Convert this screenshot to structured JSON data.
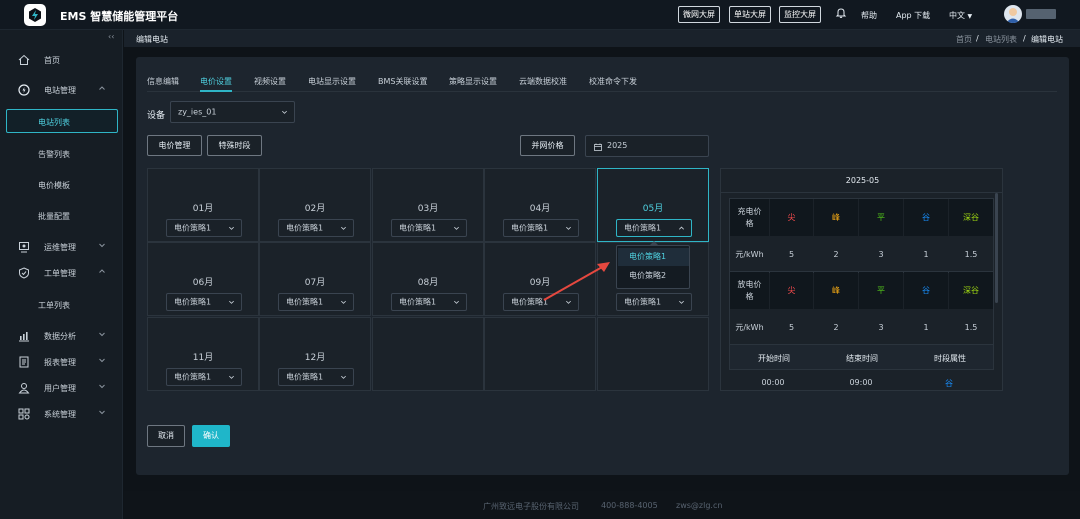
{
  "app": {
    "title": "EMS 智慧储能管理平台"
  },
  "topbar": {
    "buttons": [
      "微网大屏",
      "单站大屏",
      "监控大屏"
    ],
    "help": "帮助",
    "app_download": "App 下载",
    "language": "中文"
  },
  "sidebar": {
    "items": [
      {
        "label": "首页",
        "icon": "home-icon"
      },
      {
        "label": "电站管理",
        "icon": "station-icon"
      },
      {
        "label": "运维管理",
        "icon": "maintenance-icon"
      },
      {
        "label": "工单管理",
        "icon": "workorder-icon"
      },
      {
        "label": "数据分析",
        "icon": "chart-icon"
      },
      {
        "label": "报表管理",
        "icon": "report-icon"
      },
      {
        "label": "用户管理",
        "icon": "user-icon"
      },
      {
        "label": "系统管理",
        "icon": "system-icon"
      }
    ],
    "station_subitems": [
      "电站列表",
      "告警列表",
      "电价模板",
      "批量配置"
    ],
    "workorder_subitems": [
      "工单列表"
    ]
  },
  "breadcrumb": {
    "page_title": "编辑电站",
    "items": [
      "首页",
      "电站列表",
      "编辑电站"
    ]
  },
  "tabs": [
    "信息编辑",
    "电价设置",
    "视频设置",
    "电站显示设置",
    "BMS关联设置",
    "策略显示设置",
    "云端数据校准",
    "校准命令下发"
  ],
  "active_tab": 1,
  "device": {
    "label": "设备",
    "value": "zy_ies_01"
  },
  "buttons": {
    "price_manage": "电价管理",
    "special_period": "特殊时段",
    "grid_price": "并网价格",
    "cancel": "取消",
    "confirm": "确认"
  },
  "year": "2025",
  "months": [
    {
      "label": "01月",
      "strategy": "电价策略1"
    },
    {
      "label": "02月",
      "strategy": "电价策略1"
    },
    {
      "label": "03月",
      "strategy": "电价策略1"
    },
    {
      "label": "04月",
      "strategy": "电价策略1"
    },
    {
      "label": "05月",
      "strategy": "电价策略1"
    },
    {
      "label": "06月",
      "strategy": "电价策略1"
    },
    {
      "label": "07月",
      "strategy": "电价策略1"
    },
    {
      "label": "08月",
      "strategy": "电价策略1"
    },
    {
      "label": "09月",
      "strategy": "电价策略1"
    },
    {
      "label": "",
      "strategy": "电价策略1"
    },
    {
      "label": "11月",
      "strategy": "电价策略1"
    },
    {
      "label": "12月",
      "strategy": "电价策略1"
    }
  ],
  "dropdown_options": [
    "电价策略1",
    "电价策略2"
  ],
  "price_panel": {
    "title": "2025-05",
    "charge_label": "充电价格",
    "discharge_label": "放电价格",
    "unit": "元/kWh",
    "tiers": [
      {
        "name": "尖",
        "color": "#ff4d4f"
      },
      {
        "name": "峰",
        "color": "#faad14"
      },
      {
        "name": "平",
        "color": "#52c41a"
      },
      {
        "name": "谷",
        "color": "#1890ff"
      },
      {
        "name": "深谷",
        "color": "#a0d911"
      }
    ],
    "charge_values": [
      "5",
      "2",
      "3",
      "1",
      "1.5"
    ],
    "discharge_values": [
      "5",
      "2",
      "3",
      "1",
      "1.5"
    ],
    "time_headers": [
      "开始时间",
      "结束时间",
      "时段属性"
    ],
    "time_rows": [
      {
        "start": "00:00",
        "end": "09:00",
        "attr": "谷"
      }
    ]
  },
  "footer": {
    "company": "广州致远电子股份有限公司",
    "phone": "400-888-4005",
    "email": "zws@zlg.cn"
  }
}
